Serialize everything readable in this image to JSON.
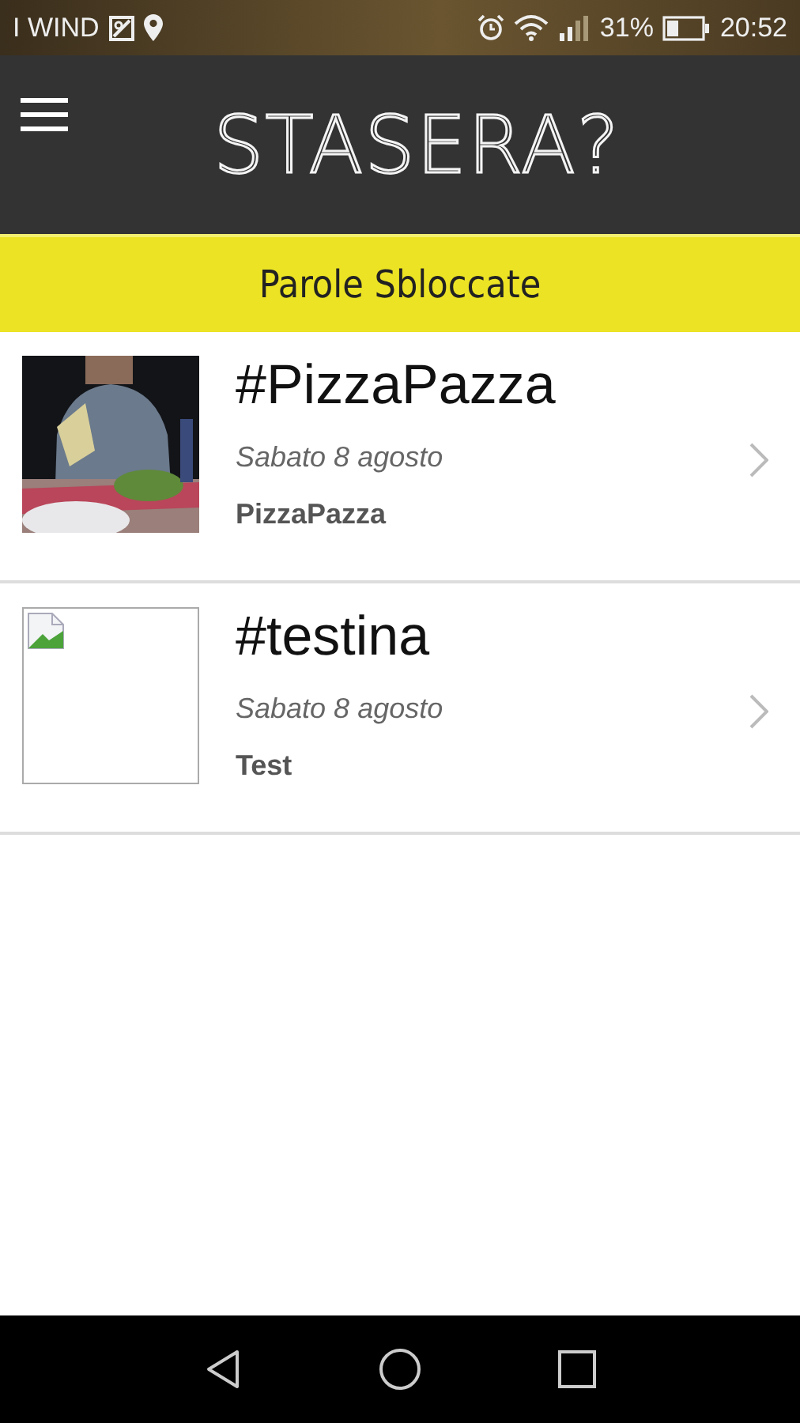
{
  "status_bar": {
    "carrier": "I WIND",
    "battery": "31%",
    "time": "20:52"
  },
  "header": {
    "title": "STASERA?"
  },
  "banner": {
    "title": "Parole Sbloccate"
  },
  "items": [
    {
      "title": "#PizzaPazza",
      "date": "Sabato 8 agosto",
      "place": "PizzaPazza"
    },
    {
      "title": "#testina",
      "date": "Sabato 8 agosto",
      "place": "Test",
      "image": {
        "kind": "broken"
      }
    }
  ]
}
